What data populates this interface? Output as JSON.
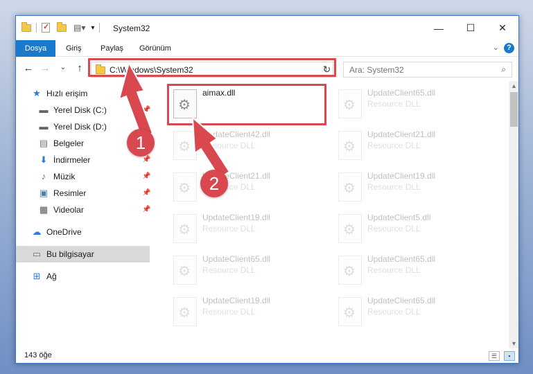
{
  "window": {
    "title": "System32"
  },
  "ribbon": {
    "tabs": [
      "Dosya",
      "Giriş",
      "Paylaş",
      "Görünüm"
    ],
    "help": "?"
  },
  "nav": {
    "address_path": "C:\\Windows\\System32",
    "search_placeholder": "Ara: System32"
  },
  "sidebar": {
    "items": [
      {
        "label": "Hızlı erişim",
        "icon": "star-icon"
      },
      {
        "label": "Yerel Disk (C:)",
        "icon": "drive-icon"
      },
      {
        "label": "Yerel Disk (D:)",
        "icon": "drive-icon"
      },
      {
        "label": "Belgeler",
        "icon": "documents-icon"
      },
      {
        "label": "İndirmeler",
        "icon": "download-icon"
      },
      {
        "label": "Müzik",
        "icon": "music-icon"
      },
      {
        "label": "Resimler",
        "icon": "pictures-icon"
      },
      {
        "label": "Videolar",
        "icon": "video-icon"
      },
      {
        "label": "OneDrive",
        "icon": "cloud-icon"
      },
      {
        "label": "Bu bilgisayar",
        "icon": "computer-icon"
      },
      {
        "label": "Ağ",
        "icon": "network-icon"
      }
    ]
  },
  "files": [
    {
      "name": "aimax.dll",
      "type": ""
    },
    {
      "name": "UpdateClient65.dll",
      "type": "Resource DLL"
    },
    {
      "name": "UpdateClient42.dll",
      "type": "Resource DLL"
    },
    {
      "name": "UpdateClient21.dll",
      "type": "Resource DLL"
    },
    {
      "name": "UpdateClient21.dll",
      "type": "Resource DLL"
    },
    {
      "name": "UpdateClient19.dll",
      "type": "Resource DLL"
    },
    {
      "name": "UpdateClient19.dll",
      "type": "Resource DLL"
    },
    {
      "name": "UpdateClient5.dll",
      "type": "Resource DLL"
    },
    {
      "name": "UpdateClient65.dll",
      "type": "Resource DLL"
    },
    {
      "name": "UpdateClient65.dll",
      "type": "Resource DLL"
    },
    {
      "name": "UpdateClient19.dll",
      "type": "Resource DLL"
    },
    {
      "name": "UpdateClient65.dll",
      "type": "Resource DLL"
    }
  ],
  "status": {
    "item_count": "143 öğe"
  },
  "annotations": {
    "step1": "1",
    "step2": "2",
    "color": "#d9484e"
  }
}
